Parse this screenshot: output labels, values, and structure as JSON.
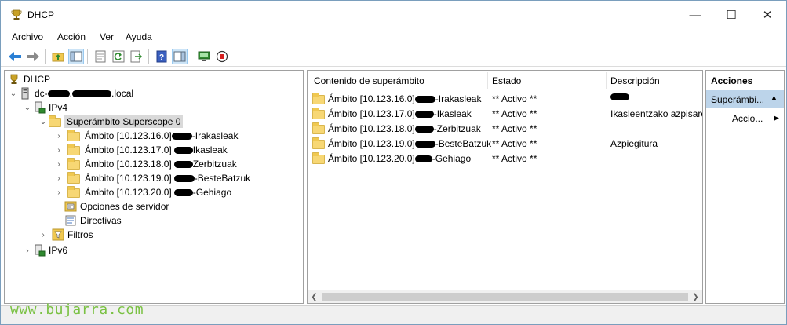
{
  "window": {
    "title": "DHCP",
    "controls": {
      "minimize": "—",
      "maximize": "☐",
      "close": "✕"
    }
  },
  "menu": [
    "Archivo",
    "Acción",
    "Ver",
    "Ayuda"
  ],
  "tree": {
    "root": "DHCP",
    "server_prefix": "dc-",
    "server_suffix": ".local",
    "ipv4": "IPv4",
    "superscope": "Superámbito Superscope 0",
    "scopes": [
      {
        "prefix": "Ámbito [10.123.16.0]",
        "suffix": "-Irakasleak"
      },
      {
        "prefix": "Ámbito [10.123.17.0]",
        "suffix": "Ikasleak"
      },
      {
        "prefix": "Ámbito [10.123.18.0]",
        "suffix": "Zerbitzuak"
      },
      {
        "prefix": "Ámbito [10.123.19.0]",
        "suffix": "-BesteBatzuk"
      },
      {
        "prefix": "Ámbito [10.123.20.0]",
        "suffix": "-Gehiago"
      }
    ],
    "server_options": "Opciones de servidor",
    "policies": "Directivas",
    "filters": "Filtros",
    "ipv6": "IPv6"
  },
  "list": {
    "columns": [
      "Contenido de superámbito",
      "Estado",
      "Descripción"
    ],
    "rows": [
      {
        "prefix": "Ámbito [10.123.16.0]",
        "suffix": "-Irakasleak",
        "status": "** Activo **",
        "description": ""
      },
      {
        "prefix": "Ámbito [10.123.17.0]",
        "suffix": "-Ikasleak",
        "status": "** Activo **",
        "description": "Ikasleentzako azpisare"
      },
      {
        "prefix": "Ámbito [10.123.18.0]",
        "suffix": "-Zerbitzuak",
        "status": "** Activo **",
        "description": ""
      },
      {
        "prefix": "Ámbito [10.123.19.0]",
        "suffix": "-BesteBatzuk",
        "status": "** Activo **",
        "description": "Azpiegitura"
      },
      {
        "prefix": "Ámbito [10.123.20.0]",
        "suffix": "-Gehiago",
        "status": "** Activo **",
        "description": ""
      }
    ]
  },
  "actions": {
    "header": "Acciones",
    "section": "Superámbi...",
    "item": "Accio..."
  },
  "watermark": "www.bujarra.com"
}
